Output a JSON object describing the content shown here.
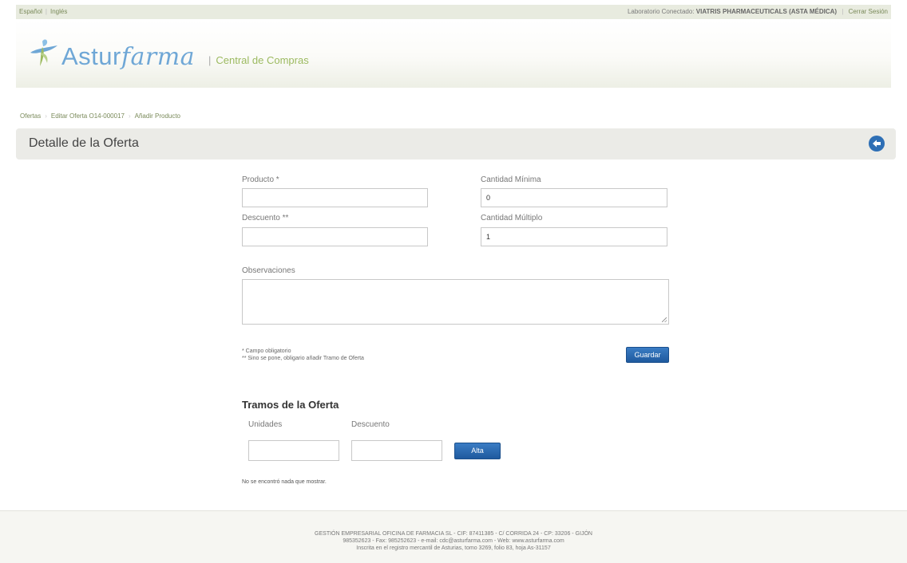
{
  "topbar": {
    "lang_es": "Español",
    "lang_en": "Inglés",
    "connected_label": "Laboratorio Conectado:",
    "connected_lab": "VIATRIS PHARMACEUTICALS (ASTA MÉDICA)",
    "logout": "Cerrar Sesión"
  },
  "header": {
    "brand_main": "Astur",
    "brand_italic": "farma",
    "tagline": "Central de Compras"
  },
  "breadcrumb": {
    "items": [
      "Ofertas",
      "Editar Oferta O14-000017",
      "Añadir Producto"
    ]
  },
  "page": {
    "title": "Detalle de la Oferta"
  },
  "form": {
    "producto_label": "Producto *",
    "producto_value": "",
    "cantidad_minima_label": "Cantidad Mínima",
    "cantidad_minima_value": "0",
    "descuento_label": "Descuento **",
    "descuento_value": "",
    "cantidad_multiplo_label": "Cantidad Múltiplo",
    "cantidad_multiplo_value": "1",
    "observaciones_label": "Observaciones",
    "observaciones_value": "",
    "note_required": "* Campo obligatorio",
    "note_optional": "** Sino se pone, obligario añadir Tramo de Oferta",
    "save_button": "Guardar"
  },
  "tramos": {
    "heading": "Tramos de la Oferta",
    "unidades_label": "Unidades",
    "descuento_label": "Descuento",
    "alta_button": "Alta",
    "empty_message": "No se encontró nada que mostrar."
  },
  "footer": {
    "line1": "GESTIÓN EMPRESARIAL OFICINA DE FARMACIA SL - CIF: 87411385 - C/ CORRIDA 24 - CP: 33206 - GIJÓN",
    "line2": "985352623 - Fax: 985252623 - e-mail: cdc@asturfarma.com - Web: www.asturfarma.com",
    "line3": "Inscrita en el registro mercantil de Asturias, tomo 3269, folio 83, hoja As-31157"
  },
  "colors": {
    "accent_green": "#9cba60",
    "brand_blue": "#6fa7d6",
    "button_blue": "#2e6fb5"
  },
  "icons": {
    "back": "arrow-left-circle-icon",
    "logo": "cross-figure-logo-icon"
  }
}
